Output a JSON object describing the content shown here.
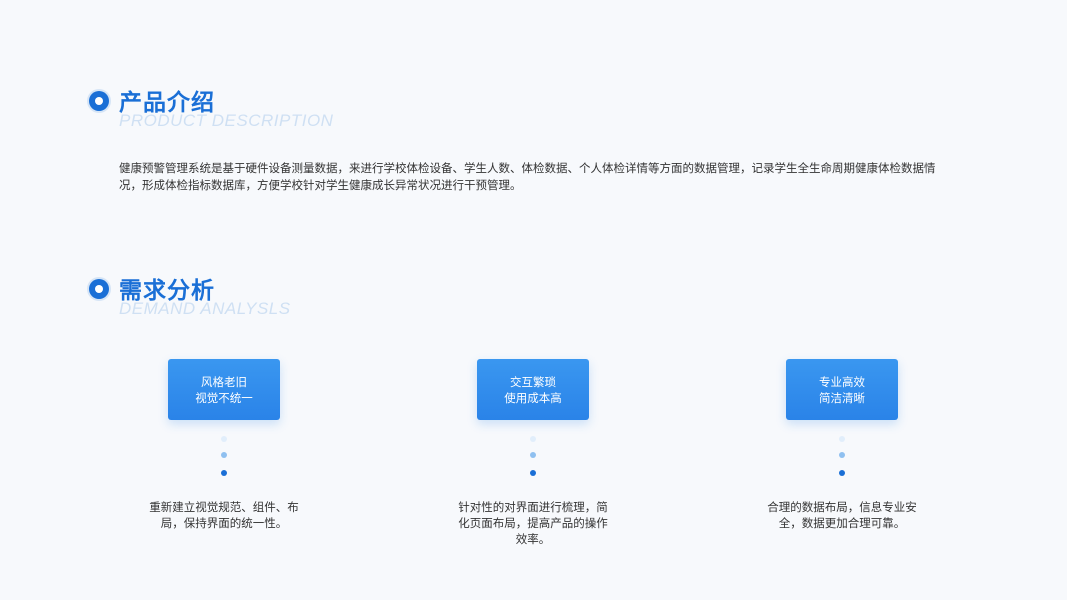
{
  "section1": {
    "title": "产品介绍",
    "subtitle": "PRODUCT DESCRIPTION",
    "description": "健康预警管理系统是基于硬件设备测量数据，来进行学校体检设备、学生人数、体检数据、个人体检详情等方面的数据管理，记录学生全生命周期健康体检数据情况，形成体检指标数据库，方便学校针对学生健康成长异常状况进行干预管理。"
  },
  "section2": {
    "title": "需求分析",
    "subtitle": "DEMAND  ANALYSLS",
    "items": [
      {
        "line1": "风格老旧",
        "line2": "视觉不统一",
        "note": "重新建立视觉规范、组件、布局，保持界面的统一性。"
      },
      {
        "line1": "交互繁琐",
        "line2": "使用成本高",
        "note": "针对性的对界面进行梳理，简化页面布局，提高产品的操作效率。"
      },
      {
        "line1": "专业高效",
        "line2": "简洁清晰",
        "note": "合理的数据布局，信息专业安全，数据更加合理可靠。"
      }
    ]
  },
  "colors": {
    "accent": "#1a6fd6",
    "card": "#2a83e8",
    "subtitle": "#cfe0f3",
    "background": "#f7f9fc"
  }
}
